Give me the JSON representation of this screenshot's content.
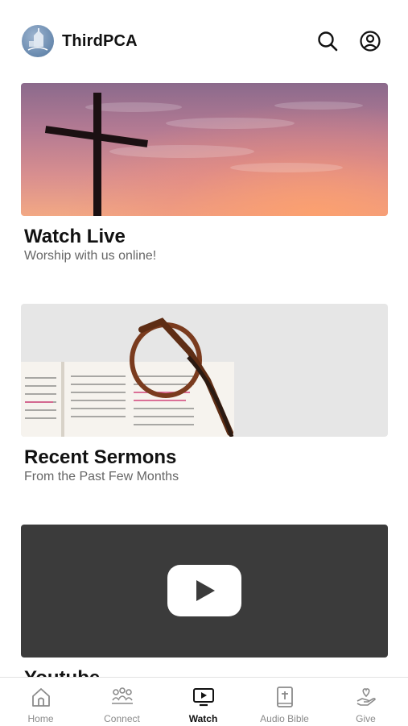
{
  "header": {
    "app_name": "ThirdPCA",
    "logo_icon": "church-logo-icon",
    "search_icon": "search-icon",
    "profile_icon": "profile-icon"
  },
  "cards": [
    {
      "title": "Watch Live",
      "subtitle": "Worship with us online!",
      "image": "sunset-cross-image"
    },
    {
      "title": "Recent Sermons",
      "subtitle": "From the Past Few Months",
      "image": "bible-glasses-image"
    },
    {
      "title": "Youtube",
      "subtitle": "",
      "image": "youtube-play-icon"
    }
  ],
  "tabbar": {
    "active": "Watch",
    "tabs": [
      {
        "label": "Home",
        "icon": "home-icon"
      },
      {
        "label": "Connect",
        "icon": "people-icon"
      },
      {
        "label": "Watch",
        "icon": "tv-play-icon"
      },
      {
        "label": "Audio Bible",
        "icon": "bible-icon"
      },
      {
        "label": "Give",
        "icon": "hand-heart-icon"
      }
    ]
  },
  "colors": {
    "accent": "#111111",
    "inactive_tab": "#8a8a8a",
    "youtube_bg": "#3b3b3b"
  }
}
